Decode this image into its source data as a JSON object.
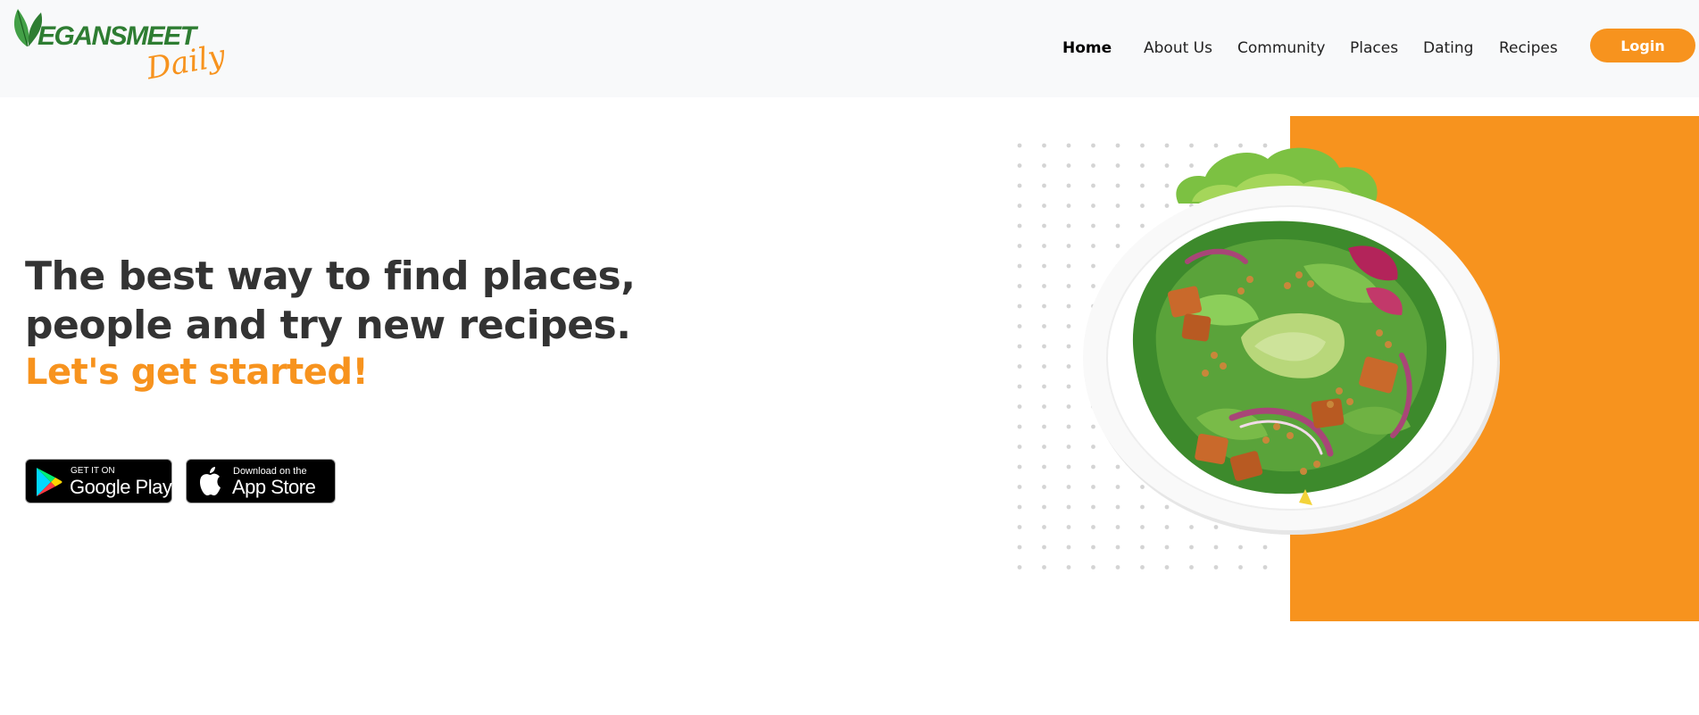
{
  "header": {
    "logo": {
      "word": "EGANSMEET",
      "tagline": "Daily"
    },
    "nav": [
      {
        "label": "Home",
        "active": true
      },
      {
        "label": "About Us",
        "active": false
      },
      {
        "label": "Community",
        "active": false
      },
      {
        "label": "Places",
        "active": false
      },
      {
        "label": "Dating",
        "active": false
      },
      {
        "label": "Recipes",
        "active": false
      }
    ],
    "login_label": "Login"
  },
  "hero": {
    "title_line1": "The best way to find places,",
    "title_line2": "people and try new recipes.",
    "cta": "Let's get started!"
  },
  "badges": {
    "google": {
      "small": "GET IT ON",
      "big": "Google Play",
      "icon": "google-play-icon"
    },
    "apple": {
      "small": "Download on the",
      "big": "App Store",
      "icon": "apple-icon"
    }
  },
  "colors": {
    "accent": "#f7931e",
    "brand_green": "#2e7d32",
    "text_dark": "#333333",
    "header_bg": "#f8f9fa"
  },
  "images": {
    "hero_image": "salad-bowl-image",
    "background_pattern": "dot-grid-pattern"
  }
}
